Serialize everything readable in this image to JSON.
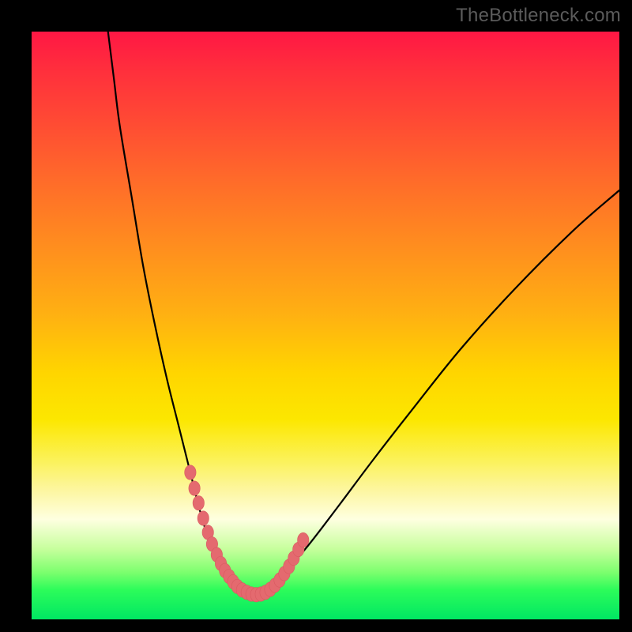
{
  "watermark": "TheBottleneck.com",
  "colors": {
    "curve_stroke": "#000000",
    "dot_fill": "#e46a6f",
    "dot_stroke": "#d95a60",
    "gradient_top": "#ff1744",
    "gradient_bottom": "#00e763",
    "frame_bg": "#000000"
  },
  "chart_data": {
    "type": "line",
    "title": "",
    "xlabel": "",
    "ylabel": "",
    "xlim": [
      0,
      100
    ],
    "ylim": [
      0,
      100
    ],
    "series": [
      {
        "name": "bottleneck-curve",
        "x": [
          13,
          14,
          15,
          17,
          19,
          21,
          23,
          25,
          27,
          28.5,
          30,
          31.5,
          33,
          34,
          35,
          36,
          37,
          38,
          40,
          43,
          47,
          52,
          58,
          65,
          73,
          82,
          92,
          100
        ],
        "y": [
          100,
          92,
          84,
          72,
          60,
          50,
          41,
          33,
          25,
          19,
          14,
          10.5,
          7.8,
          6.0,
          5.0,
          4.3,
          4.0,
          4.2,
          5.2,
          8.0,
          12.5,
          19,
          27,
          36,
          46,
          56,
          66,
          73
        ]
      }
    ],
    "markers": {
      "name": "dotted-highlight",
      "style": "round-bead",
      "x": [
        27,
        27.7,
        28.4,
        29.2,
        30.0,
        30.7,
        31.5,
        32.2,
        32.9,
        33.6,
        34.3,
        35.0,
        35.8,
        36.6,
        37.4,
        38.2,
        39.0,
        39.8,
        40.6,
        41.4,
        42.2,
        43.0,
        43.8,
        44.6,
        45.4,
        46.2
      ],
      "y": [
        25.0,
        22.3,
        19.8,
        17.2,
        14.8,
        12.8,
        11.0,
        9.5,
        8.3,
        7.3,
        6.4,
        5.6,
        5.0,
        4.6,
        4.3,
        4.2,
        4.3,
        4.6,
        5.1,
        5.8,
        6.7,
        7.8,
        9.0,
        10.4,
        11.9,
        13.5
      ]
    },
    "annotations": []
  }
}
